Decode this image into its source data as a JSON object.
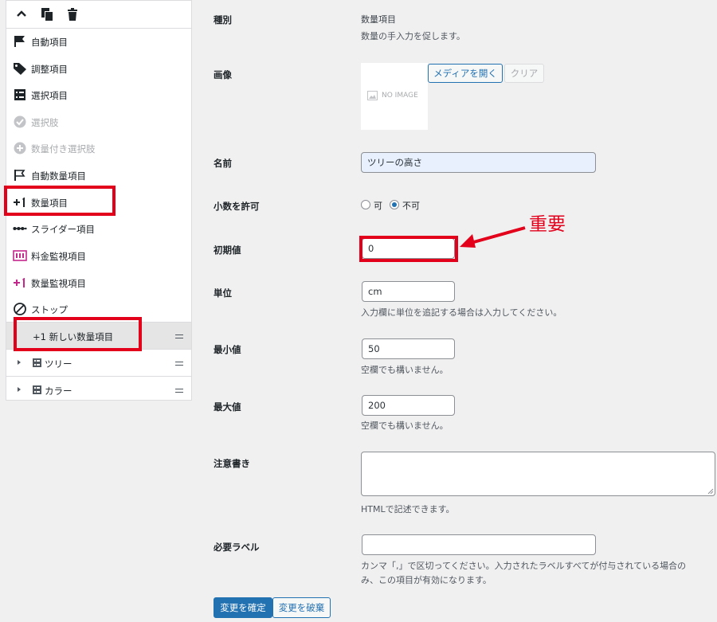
{
  "sidebar": {
    "items": [
      {
        "label": "自動項目",
        "icon": "flag-icon"
      },
      {
        "label": "調整項目",
        "icon": "tag-icon"
      },
      {
        "label": "選択項目",
        "icon": "list-icon"
      },
      {
        "label": "選択肢",
        "icon": "check-circle-icon"
      },
      {
        "label": "数量付き選択肢",
        "icon": "plus-circle-icon"
      },
      {
        "label": "自動数量項目",
        "icon": "outline-flag-icon"
      },
      {
        "label": "数量項目",
        "icon": "plus-one-icon"
      },
      {
        "label": "スライダー項目",
        "icon": "slider-dots-icon"
      },
      {
        "label": "料金監視項目",
        "icon": "counter-icon"
      },
      {
        "label": "数量監視項目",
        "icon": "plus-one-pink-icon"
      },
      {
        "label": "ストップ",
        "icon": "stop-icon"
      }
    ],
    "subitems": [
      {
        "label": "+1 新しい数量項目"
      },
      {
        "label": "ツリー"
      },
      {
        "label": "カラー"
      }
    ]
  },
  "form": {
    "type": {
      "label": "種別",
      "value": "数量項目",
      "desc": "数量の手入力を促します。"
    },
    "image": {
      "label": "画像",
      "placeholder": "NO IMAGE",
      "open_button": "メディアを開く",
      "clear_button": "クリア"
    },
    "name": {
      "label": "名前",
      "value": "ツリーの高さ"
    },
    "decimal": {
      "label": "小数を許可",
      "option_yes": "可",
      "option_no": "不可",
      "selected": "不可"
    },
    "initial": {
      "label": "初期値",
      "value": "0"
    },
    "unit": {
      "label": "単位",
      "value": "cm",
      "help": "入力欄に単位を追記する場合は入力してください。"
    },
    "min": {
      "label": "最小値",
      "value": "50",
      "help": "空欄でも構いません。"
    },
    "max": {
      "label": "最大値",
      "value": "200",
      "help": "空欄でも構いません。"
    },
    "note": {
      "label": "注意書き",
      "value": "",
      "help": "HTMLで記述できます。"
    },
    "required_label": {
      "label": "必要ラベル",
      "value": "",
      "help_line1": "カンマ「,」で区切ってください。入力されたラベルすべてが付与されている場合の",
      "help_line2": "み、この項目が有効になります。"
    },
    "confirm_button": "変更を確定",
    "discard_button": "変更を破棄"
  },
  "annotation": {
    "text": "重要",
    "color": "#e2001a"
  }
}
